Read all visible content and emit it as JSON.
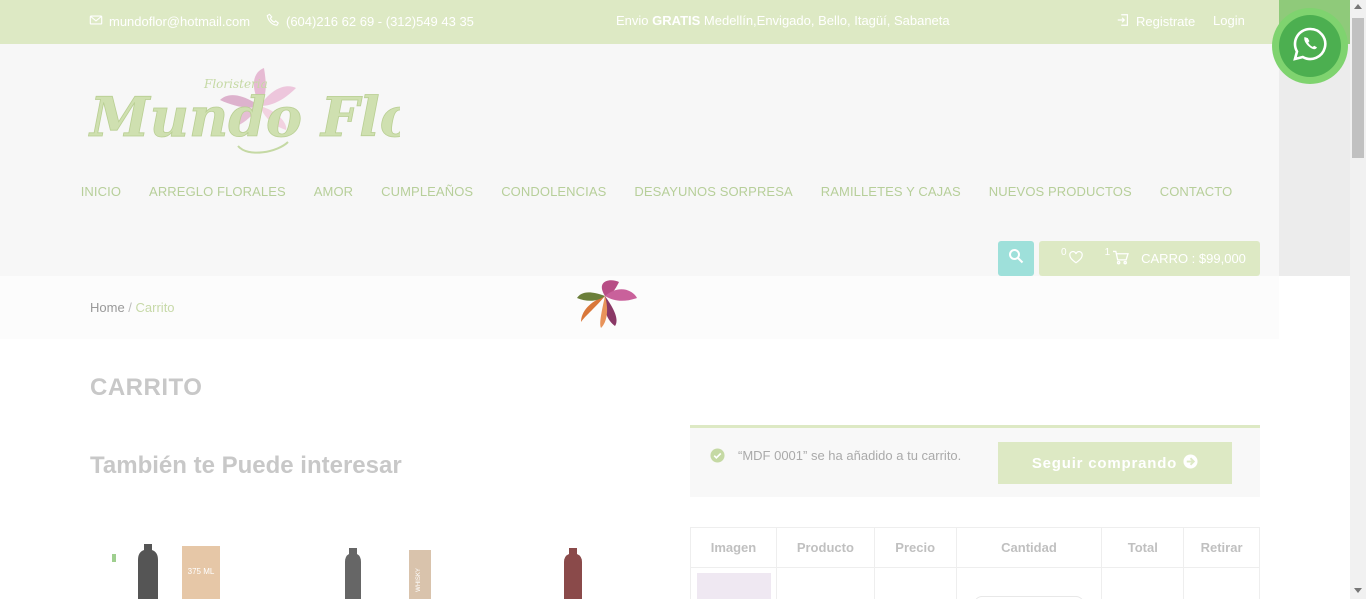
{
  "topbar": {
    "email": "mundoflor@hotmail.com",
    "phone": "(604)216 62 69 - (312)549 43 35",
    "promo_prefix": "Envio ",
    "promo_bold": "GRATIS",
    "promo_suffix": " Medellín,Envigado, Bello, Itagüí, Sabaneta",
    "register": "Registrate",
    "login": "Login"
  },
  "logo": {
    "small": "Floristeria",
    "main": "Mundo Flor"
  },
  "nav": {
    "items": [
      "INICIO",
      "ARREGLO FLORALES",
      "AMOR",
      "CUMPLEAÑOS",
      "CONDOLENCIAS",
      "DESAYUNOS SORPRESA",
      "RAMILLETES Y CAJAS",
      "NUEVOS PRODUCTOS",
      "CONTACTO"
    ]
  },
  "header_actions": {
    "wishlist_count": "0",
    "cart_count": "1",
    "cart_label": "CARRO : $99,000"
  },
  "breadcrumb": {
    "home": "Home",
    "separator": " / ",
    "current": "Carrito"
  },
  "main": {
    "page_title": "CARRITO",
    "related_title": "También te Puede interesar",
    "notice_message": "“MDF 0001” se ha añadido a tu carrito.",
    "continue_button": "Seguir comprando"
  },
  "cart_table": {
    "headers": [
      "Imagen",
      "Producto",
      "Precio",
      "Cantidad",
      "Total",
      "Retirar"
    ]
  },
  "products_preview": [
    {
      "label": "375 ML"
    },
    {
      "label": "WHISKY"
    }
  ],
  "colors": {
    "accent_green": "#dde9c4",
    "teal": "#9ee0da",
    "whatsapp": "#4caf50"
  },
  "icons": [
    "mail-icon",
    "phone-icon",
    "login-icon",
    "search-icon",
    "heart-icon",
    "cart-icon",
    "check-circle-icon",
    "arrow-right-icon",
    "whatsapp-icon"
  ]
}
